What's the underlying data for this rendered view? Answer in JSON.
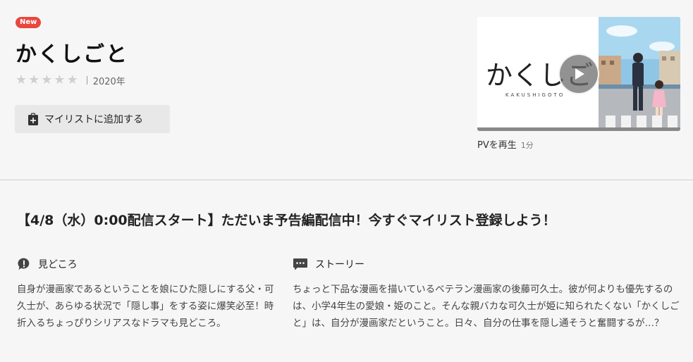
{
  "title": {
    "badge": "New",
    "name": "かくしごと",
    "year": "2020年"
  },
  "rating": {
    "value": 0,
    "max": 5
  },
  "mylist_button": {
    "label": "マイリストに追加する"
  },
  "pv": {
    "logo_text": "かくしごと",
    "logo_sub": "KAKUSHIGOTO",
    "caption": "PVを再生",
    "duration": "1分"
  },
  "headline": "【4/8（水）0:00配信スタート】ただいま予告編配信中！今すぐマイリスト登録しよう！",
  "highlights": {
    "label": "見どころ",
    "icon": "exclamation-bubble-icon",
    "body": "自身が漫画家であるということを娘にひた隠しにする父・可久士が、あらゆる状況で「隠し事」をする姿に爆笑必至！時折入るちょっぴりシリアスなドラマも見どころ。"
  },
  "story": {
    "label": "ストーリー",
    "icon": "speech-bubble-icon",
    "body": "ちょっと下品な漫画を描いているベテラン漫画家の後藤可久士。彼が何よりも優先するのは、小学4年生の愛娘・姫のこと。そんな親バカな可久士が姫に知られたくない「かくしごと」は、自分が漫画家だということ。日々、自分の仕事を隠し通そうと奮闘するが…？"
  },
  "colors": {
    "badge": "#e8473d",
    "background": "#f6f6f6",
    "button_bg": "#e8e8e8",
    "star_empty": "#cfcfcf"
  }
}
